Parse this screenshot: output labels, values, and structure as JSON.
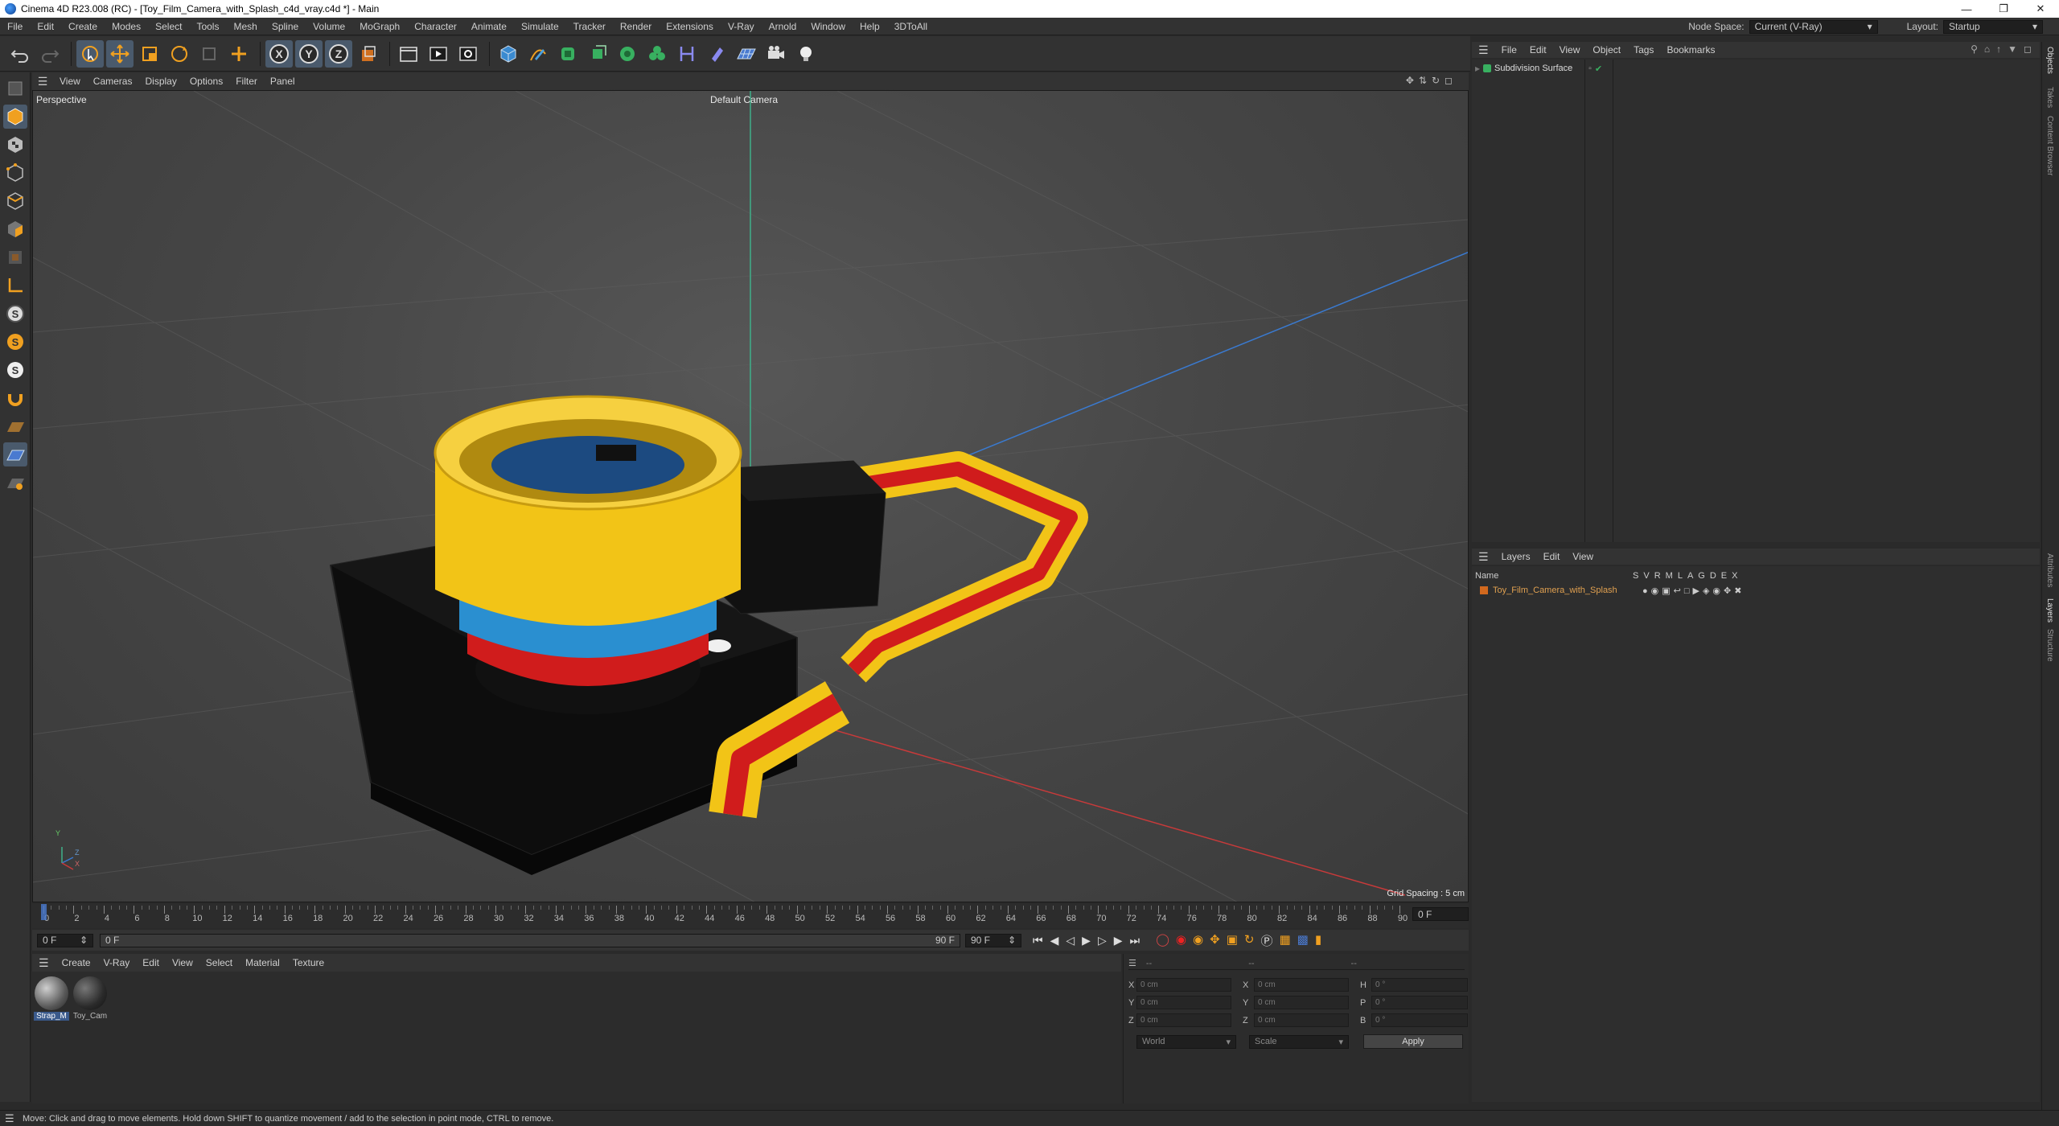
{
  "window": {
    "title": "Cinema 4D R23.008 (RC) - [Toy_Film_Camera_with_Splash_c4d_vray.c4d *] - Main",
    "minimize": "—",
    "restore": "❐",
    "close": "✕"
  },
  "menu": {
    "items": [
      "File",
      "Edit",
      "Create",
      "Modes",
      "Select",
      "Tools",
      "Mesh",
      "Spline",
      "Volume",
      "MoGraph",
      "Character",
      "Animate",
      "Simulate",
      "Tracker",
      "Render",
      "Extensions",
      "V-Ray",
      "Arnold",
      "Window",
      "Help",
      "3DToAll"
    ],
    "node_space_label": "Node Space:",
    "node_space_value": "Current (V-Ray)",
    "layout_label": "Layout:",
    "layout_value": "Startup"
  },
  "viewport": {
    "menu": [
      "View",
      "Cameras",
      "Display",
      "Options",
      "Filter",
      "Panel"
    ],
    "projection": "Perspective",
    "camera": "Default Camera",
    "grid_spacing": "Grid Spacing : 5 cm",
    "axis_y": "Y",
    "axis_z": "Z",
    "axis_x": "X"
  },
  "timeline": {
    "ticks": [
      "0",
      "2",
      "4",
      "6",
      "8",
      "10",
      "12",
      "14",
      "16",
      "18",
      "20",
      "22",
      "24",
      "26",
      "28",
      "30",
      "32",
      "34",
      "36",
      "38",
      "40",
      "42",
      "44",
      "46",
      "48",
      "50",
      "52",
      "54",
      "56",
      "58",
      "60",
      "62",
      "64",
      "66",
      "68",
      "70",
      "72",
      "74",
      "76",
      "78",
      "80",
      "82",
      "84",
      "86",
      "88",
      "90"
    ],
    "current_frame": "0 F",
    "start_frame": "0 F",
    "range_start": "0 F",
    "range_end": "90 F",
    "end_frame": "90 F"
  },
  "materials": {
    "menu": [
      "Create",
      "V-Ray",
      "Edit",
      "View",
      "Select",
      "Material",
      "Texture"
    ],
    "items": [
      {
        "name": "Strap_M"
      },
      {
        "name": "Toy_Cam"
      }
    ]
  },
  "coordinates": {
    "header": "--",
    "header2": "--",
    "header3": "--",
    "rows": [
      {
        "a": "X",
        "av": "0 cm",
        "b": "X",
        "bv": "0 cm",
        "c": "H",
        "cv": "0 °"
      },
      {
        "a": "Y",
        "av": "0 cm",
        "b": "Y",
        "bv": "0 cm",
        "c": "P",
        "cv": "0 °"
      },
      {
        "a": "Z",
        "av": "0 cm",
        "b": "Z",
        "bv": "0 cm",
        "c": "B",
        "cv": "0 °"
      }
    ],
    "space": "World",
    "mode": "Scale",
    "apply": "Apply"
  },
  "objects": {
    "menu": [
      "File",
      "Edit",
      "View",
      "Object",
      "Tags",
      "Bookmarks"
    ],
    "items": [
      {
        "name": "Subdivision Surface"
      }
    ]
  },
  "layers": {
    "menu": [
      "Layers",
      "Edit",
      "View"
    ],
    "name_col": "Name",
    "flags": [
      "S",
      "V",
      "R",
      "M",
      "L",
      "A",
      "G",
      "D",
      "E",
      "X"
    ],
    "items": [
      {
        "name": "Toy_Film_Camera_with_Splash"
      }
    ]
  },
  "side_tabs": [
    "Objects",
    "Takes",
    "Content Browser",
    "Attributes",
    "Layers",
    "Structure"
  ],
  "status": "Move: Click and drag to move elements. Hold down SHIFT to quantize movement / add to the selection in point mode, CTRL to remove.",
  "colors": {
    "accent": "#4a5a6c",
    "layer_color": "#d2691e",
    "layer_text": "#e0a050",
    "strap_yellow": "#f2c417",
    "strap_red": "#d01c1c",
    "lens_blue": "#2a8fd0"
  }
}
